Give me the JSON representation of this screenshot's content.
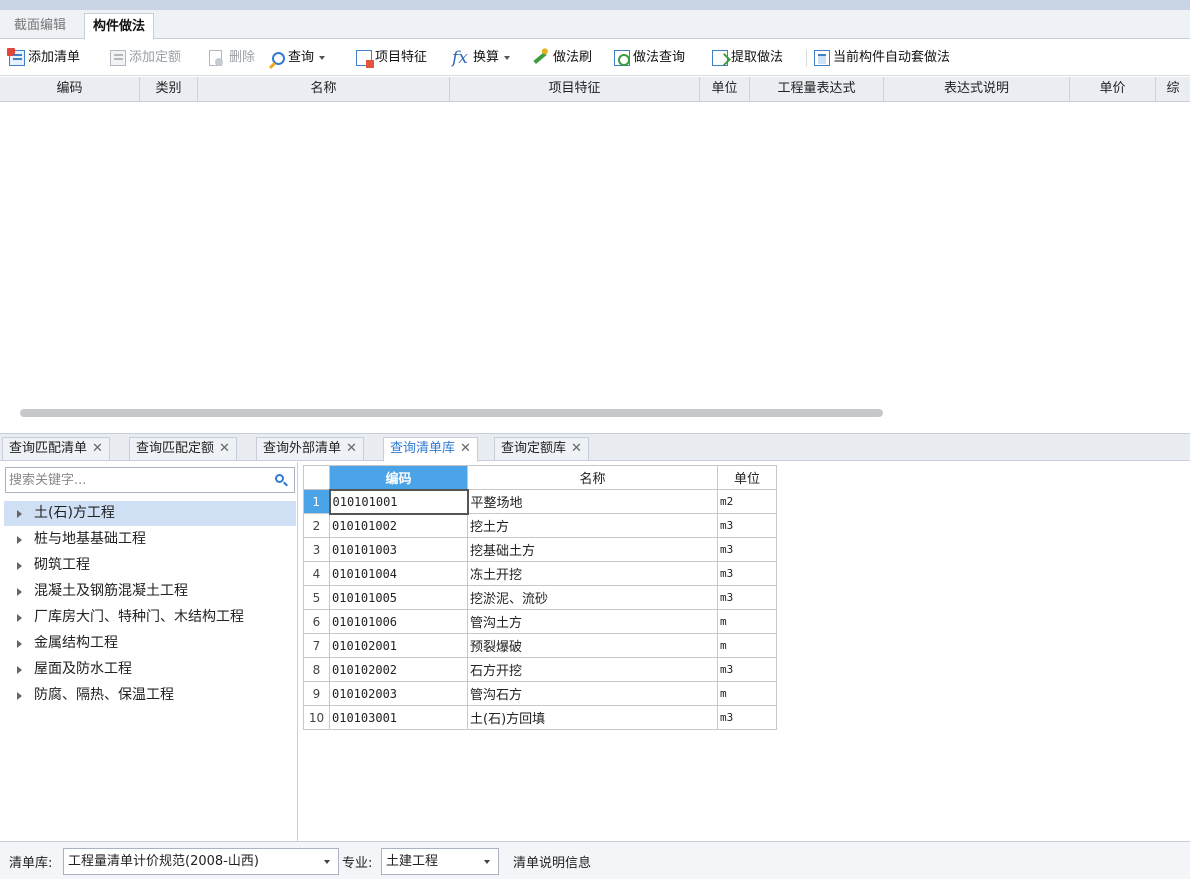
{
  "main_tabs": [
    {
      "label": "截面编辑",
      "active": false
    },
    {
      "label": "构件做法",
      "active": true
    }
  ],
  "toolbar": {
    "add_bill": "添加清单",
    "add_quota": "添加定额",
    "delete": "删除",
    "query": "查询",
    "item_feature": "项目特征",
    "convert": "换算",
    "method_brush": "做法刷",
    "method_query": "做法查询",
    "extract_method": "提取做法",
    "auto_apply": "当前构件自动套做法"
  },
  "grid": {
    "columns": [
      "编码",
      "类别",
      "名称",
      "项目特征",
      "单位",
      "工程量表达式",
      "表达式说明",
      "单价",
      "综"
    ]
  },
  "sub_tabs": [
    {
      "label": "查询匹配清单",
      "active": false
    },
    {
      "label": "查询匹配定额",
      "active": false
    },
    {
      "label": "查询外部清单",
      "active": false
    },
    {
      "label": "查询清单库",
      "active": true
    },
    {
      "label": "查询定额库",
      "active": false
    }
  ],
  "search": {
    "placeholder": "搜索关键字..."
  },
  "tree": [
    "土(石)方工程",
    "桩与地基基础工程",
    "砌筑工程",
    "混凝土及钢筋混凝土工程",
    "厂库房大门、特种门、木结构工程",
    "金属结构工程",
    "屋面及防水工程",
    "防腐、隔热、保温工程"
  ],
  "tree_selected_index": 0,
  "list": {
    "headers": {
      "code": "编码",
      "name": "名称",
      "unit": "单位"
    },
    "rows": [
      {
        "no": "1",
        "code": "010101001",
        "name": "平整场地",
        "unit": "m2"
      },
      {
        "no": "2",
        "code": "010101002",
        "name": "挖土方",
        "unit": "m3"
      },
      {
        "no": "3",
        "code": "010101003",
        "name": "挖基础土方",
        "unit": "m3"
      },
      {
        "no": "4",
        "code": "010101004",
        "name": "冻土开挖",
        "unit": "m3"
      },
      {
        "no": "5",
        "code": "010101005",
        "name": "挖淤泥、流砂",
        "unit": "m3"
      },
      {
        "no": "6",
        "code": "010101006",
        "name": "管沟土方",
        "unit": "m"
      },
      {
        "no": "7",
        "code": "010102001",
        "name": "预裂爆破",
        "unit": "m"
      },
      {
        "no": "8",
        "code": "010102002",
        "name": "石方开挖",
        "unit": "m3"
      },
      {
        "no": "9",
        "code": "010102003",
        "name": "管沟石方",
        "unit": "m"
      },
      {
        "no": "10",
        "code": "010103001",
        "name": "土(石)方回填",
        "unit": "m3"
      }
    ]
  },
  "bottom": {
    "library_label": "清单库:",
    "library_value": "工程量清单计价规范(2008-山西)",
    "specialty_label": "专业:",
    "specialty_value": "土建工程",
    "description_label": "清单说明信息"
  },
  "colors": {
    "accent": "#4ba3e8",
    "selection": "#cfe0f4",
    "tab_active_text": "#2f7bd4"
  }
}
